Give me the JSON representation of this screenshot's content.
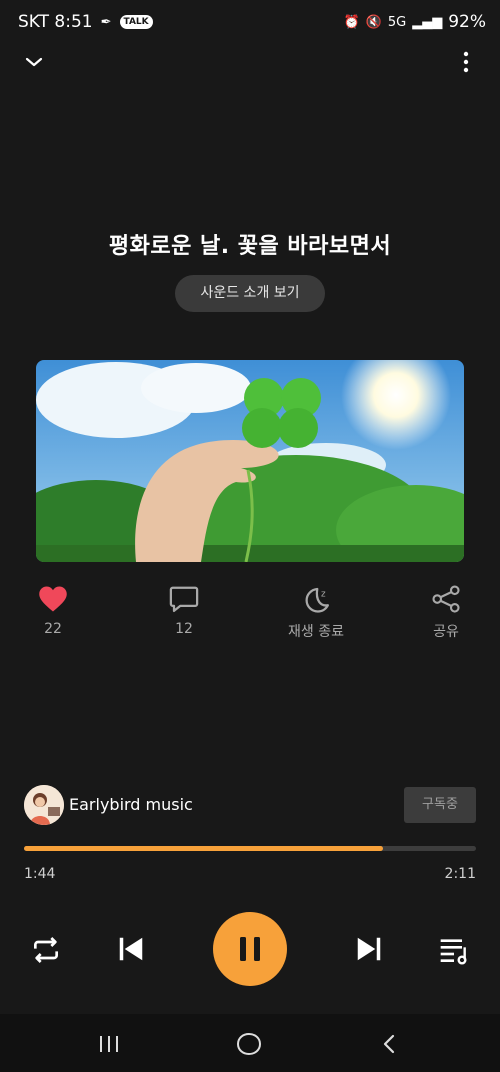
{
  "status_bar": {
    "carrier_time": "SKT 8:51",
    "talk_label": "TALK",
    "network": "5G",
    "battery": "92%"
  },
  "track": {
    "title": "평화로운 날. 꽃을 바라보면서",
    "intro_button": "사운드 소개 보기"
  },
  "actions": {
    "like_count": "22",
    "comment_count": "12",
    "sleep_timer_label": "재생 종료",
    "share_label": "공유"
  },
  "artist": {
    "name": "Earlybird music",
    "subscribe_label": "구독중"
  },
  "playback": {
    "elapsed": "1:44",
    "duration": "2:11",
    "progress_fraction": 0.794,
    "state": "playing"
  },
  "colors": {
    "accent": "#f7a13a",
    "like": "#f0485a",
    "background": "#181818"
  },
  "icons": [
    "collapse-chevron-icon",
    "more-vert-icon",
    "heart-icon",
    "comment-icon",
    "sleep-moon-icon",
    "share-icon",
    "repeat-icon",
    "previous-icon",
    "pause-icon",
    "next-icon",
    "playlist-icon",
    "recents-icon",
    "home-icon",
    "back-icon"
  ]
}
